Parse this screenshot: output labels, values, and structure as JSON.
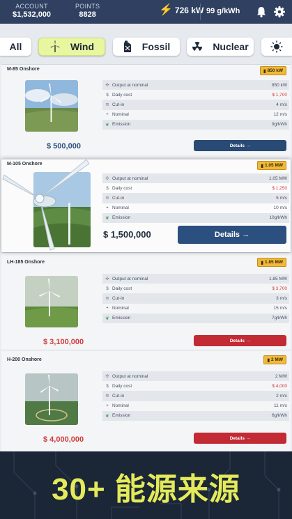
{
  "topbar": {
    "account_label": "ACCOUNT",
    "account_value": "$1,532,000",
    "points_label": "POINTS",
    "points_value": "8828",
    "power_value": "726 kW",
    "price_value": "99 g/kWh",
    "icons": [
      "bolt-icon",
      "bell-icon",
      "gear-icon"
    ]
  },
  "tabs": [
    {
      "label": "All",
      "active": false
    },
    {
      "label": "Wind",
      "active": true,
      "icon": "wind-turbine-icon"
    },
    {
      "label": "Fossil",
      "active": false,
      "icon": "fuel-can-icon"
    },
    {
      "label": "Nuclear",
      "active": false,
      "icon": "radiation-icon"
    },
    {
      "label": "",
      "active": false,
      "icon": "sun-icon"
    }
  ],
  "spec_labels": {
    "output": "Output at nominal",
    "cost": "Daily cost",
    "cutin": "Cut-in",
    "nominal": "Nominal",
    "emission": "Emission"
  },
  "details_label": "Details →",
  "cards": [
    {
      "name": "M-85 Onshore",
      "badge": "850 kW",
      "output": "850 kW",
      "cost": "$ 1,700",
      "cutin": "4 m/s",
      "nominal": "12 m/s",
      "emission": "9g/kWh",
      "price": "$ 500,000",
      "affordable": true
    },
    {
      "name": "M-105 Onshore",
      "badge": "1.05 MW",
      "output": "1.05 MW",
      "cost": "$ 1,250",
      "cutin": "5 m/s",
      "nominal": "10 m/s",
      "emission": "10g/kWh",
      "price": "$ 1,500,000",
      "affordable": true
    },
    {
      "name": "LH-185 Onshore",
      "badge": "1.85 MW",
      "output": "1.85 MW",
      "cost": "$ 3,700",
      "cutin": "3 m/s",
      "nominal": "15 m/s",
      "emission": "7g/kWh",
      "price": "$ 3,100,000",
      "affordable": false
    },
    {
      "name": "H-200 Onshore",
      "badge": "2 MW",
      "output": "2 MW",
      "cost": "$ 4,000",
      "cutin": "2 m/s",
      "nominal": "11 m/s",
      "emission": "6g/kWh",
      "price": "$ 4,000,000",
      "affordable": false
    }
  ],
  "footer": {
    "slogan": "30+ 能源来源"
  },
  "colors": {
    "accent": "#e4ea5a",
    "active_tab": "#e8f6a0",
    "badge": "#f0b93a",
    "button_blue": "#284a74",
    "button_red": "#c22a34",
    "price_red": "#d23b3b",
    "price_blue": "#2b4f7e"
  }
}
